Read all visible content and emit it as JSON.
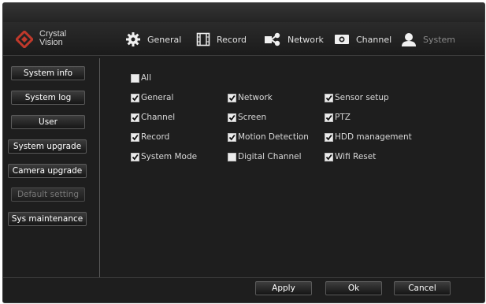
{
  "brand": {
    "line1": "Crystal",
    "line2": "Vision"
  },
  "tabs": [
    {
      "label": "General",
      "icon": "gear-icon",
      "active": false
    },
    {
      "label": "Record",
      "icon": "film-icon",
      "active": false
    },
    {
      "label": "Network",
      "icon": "network-icon",
      "active": false
    },
    {
      "label": "Channel",
      "icon": "camera-icon",
      "active": false
    },
    {
      "label": "System",
      "icon": "user-icon",
      "active": true
    }
  ],
  "sidebar": {
    "items": [
      {
        "label": "System info",
        "disabled": false
      },
      {
        "label": "System log",
        "disabled": false
      },
      {
        "label": "User",
        "disabled": false
      },
      {
        "label": "System upgrade",
        "disabled": false
      },
      {
        "label": "Camera upgrade",
        "disabled": false
      },
      {
        "label": "Default setting",
        "disabled": true
      },
      {
        "label": "Sys maintenance",
        "disabled": false
      }
    ]
  },
  "options": {
    "all": {
      "label": "All",
      "checked": false
    },
    "items": [
      {
        "label": "General",
        "checked": true
      },
      {
        "label": "Network",
        "checked": true
      },
      {
        "label": "Sensor setup",
        "checked": true
      },
      {
        "label": "Channel",
        "checked": true
      },
      {
        "label": "Screen",
        "checked": true
      },
      {
        "label": "PTZ",
        "checked": true
      },
      {
        "label": "Record",
        "checked": true
      },
      {
        "label": "Motion Detection",
        "checked": true
      },
      {
        "label": "HDD management",
        "checked": true
      },
      {
        "label": "System Mode",
        "checked": true
      },
      {
        "label": "Digital Channel",
        "checked": false
      },
      {
        "label": "Wifi Reset",
        "checked": true
      }
    ]
  },
  "footer": {
    "apply": "Apply",
    "ok": "Ok",
    "cancel": "Cancel"
  },
  "colors": {
    "background": "#1e1e1e",
    "text": "#d8d8d8",
    "disabled_text": "#777777",
    "logo_red": "#c0392b"
  }
}
